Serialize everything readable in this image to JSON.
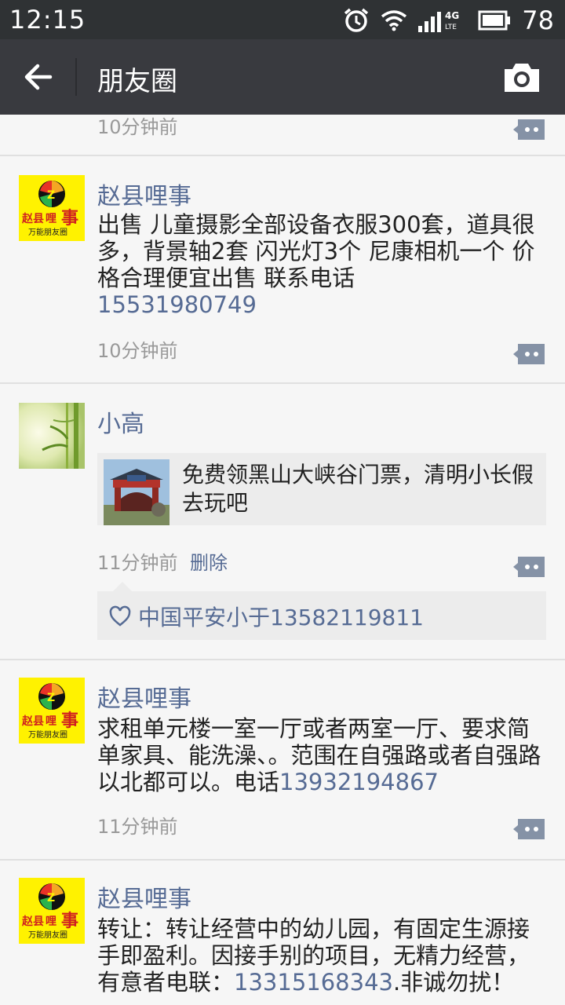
{
  "status": {
    "time": "12:15",
    "network": "4G LTE",
    "battery": "78"
  },
  "nav": {
    "title": "朋友圈",
    "back_icon": "arrow-left-icon",
    "camera_icon": "camera-icon"
  },
  "logo": {
    "top": "Z",
    "brand_a": "赵县",
    "brand_b": "哩",
    "brand_c": "事",
    "tagline": "万能朋友圈"
  },
  "colors": {
    "link": "#566b94",
    "navbar": "#393a3f",
    "statusbar": "#2f3234",
    "background": "#f6f6f6"
  },
  "posts": [
    {
      "time": "10分钟前"
    },
    {
      "author": "赵县哩事",
      "text": "出售  儿童摄影全部设备衣服300套，道具很多，背景轴2套 闪光灯3个  尼康相机一个  价格合理便宜出售 联系电话",
      "phone": "15531980749",
      "time": "10分钟前"
    },
    {
      "author": "小高",
      "link_text": "免费领黑山大峡谷门票，清明小长假去玩吧",
      "time": "11分钟前",
      "delete": "删除",
      "likes": "中国平安小于13582119811"
    },
    {
      "author": "赵县哩事",
      "text": "求租单元楼一室一厅或者两室一厅、要求简单家具、能洗澡、。范围在自强路或者自强路以北都可以。电话",
      "phone": "13932194867",
      "time": "11分钟前"
    },
    {
      "author": "赵县哩事",
      "text_a": "转让：转让经营中的幼儿园，有固定生源接手即盈利。因接手别的项目，无精力经营，有意者电联：",
      "phone": "13315168343",
      "text_b": ".非诚勿扰！"
    }
  ]
}
